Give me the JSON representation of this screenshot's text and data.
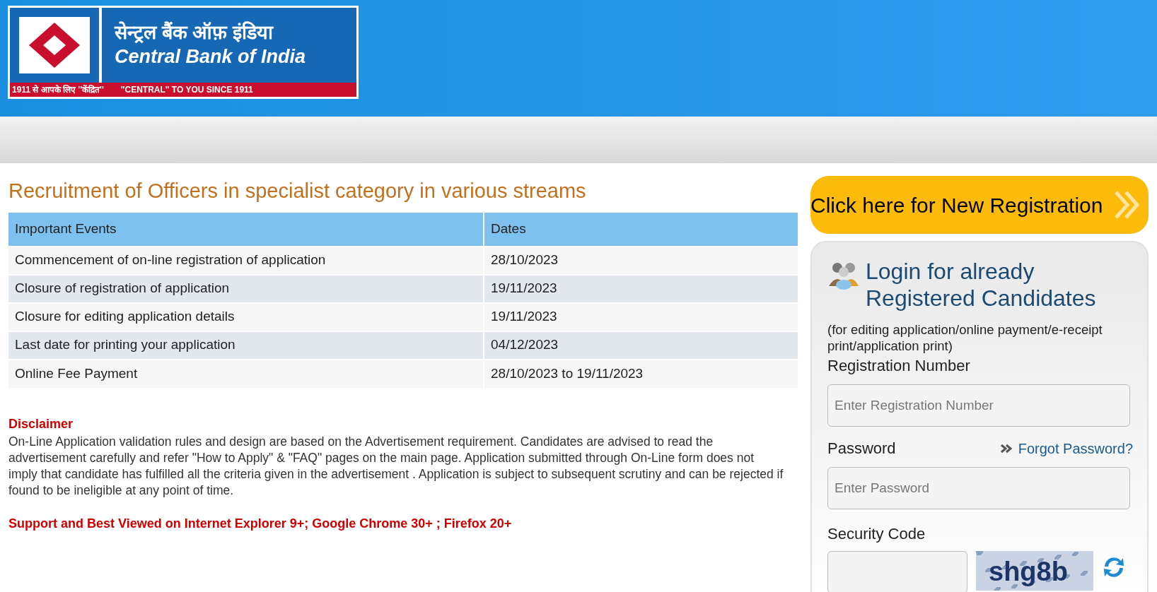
{
  "header": {
    "logo": {
      "hindi_name": "सेन्ट्रल बैंक ऑफ़ इंडिया",
      "english_name": "Central Bank of India",
      "tagline_hindi": "1911 से आपके लिए ''केंद्रित''",
      "tagline_english": "\"CENTRAL\" TO YOU SINCE 1911"
    }
  },
  "page_title": "Recruitment of Officers in specialist category in various streams",
  "table": {
    "columns": [
      "Important Events",
      "Dates"
    ],
    "rows": [
      [
        "Commencement of on-line registration of application",
        "28/10/2023"
      ],
      [
        "Closure of registration of application",
        "19/11/2023"
      ],
      [
        "Closure for editing application details",
        "19/11/2023"
      ],
      [
        "Last date for printing your application",
        "04/12/2023"
      ],
      [
        "Online Fee Payment",
        "28/10/2023 to 19/11/2023"
      ]
    ]
  },
  "disclaimer": {
    "title": "Disclaimer",
    "text": "On-Line Application validation rules and design are based on the Advertisement requirement. Candidates are advised to read the advertisement carefully and refer \"How to Apply\" & \"FAQ\" pages on the main page. Application submitted through On-Line form does not imply that candidate has fulfilled all the criteria given in the advertisement . Application is subject to subsequent scrutiny and can be rejected if found to be ineligible at any point of time."
  },
  "browser_note": "Support and Best Viewed on Internet Explorer 9+; Google Chrome 30+ ; Firefox 20+",
  "new_registration_button": "Click here for New Registration",
  "login": {
    "title_line1": "Login for already",
    "title_line2": "Registered Candidates",
    "subtitle": "(for editing application/online payment/e-receipt print/application print)",
    "registration_label": "Registration Number",
    "registration_placeholder": "Enter Registration Number",
    "password_label": "Password",
    "forgot_link": "Forgot Password?",
    "password_placeholder": "Enter Password",
    "security_label": "Security Code",
    "captcha": "shg8b"
  }
}
